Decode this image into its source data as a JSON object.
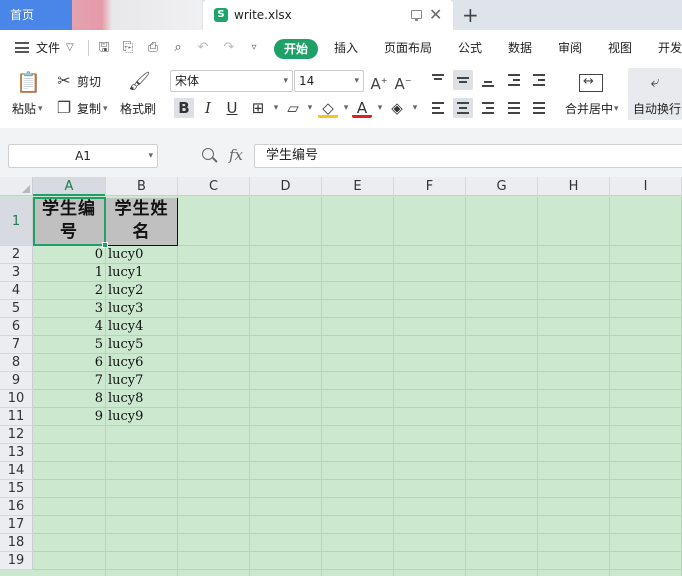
{
  "tabs": {
    "home": "首页",
    "file": "write.xlsx",
    "add": "+"
  },
  "menu": {
    "file": "文件",
    "items": [
      "开始",
      "插入",
      "页面布局",
      "公式",
      "数据",
      "审阅",
      "视图",
      "开发"
    ]
  },
  "ribbon": {
    "paste": "粘贴",
    "cut": "剪切",
    "copy": "复制",
    "format_painter": "格式刷",
    "font_name": "宋体",
    "font_size": "14",
    "merge_center": "合并居中",
    "wrap_text": "自动换行"
  },
  "formula": {
    "cell_ref": "A1",
    "fx": "fx",
    "value": "学生编号"
  },
  "sheet": {
    "columns": [
      "A",
      "B",
      "C",
      "D",
      "E",
      "F",
      "G",
      "H",
      "I"
    ],
    "rows": [
      "1",
      "2",
      "3",
      "4",
      "5",
      "6",
      "7",
      "8",
      "9",
      "10",
      "11",
      "12",
      "13",
      "14",
      "15",
      "16",
      "17",
      "18",
      "19"
    ],
    "header": {
      "a1": "学生编号",
      "b1": "学生姓名"
    },
    "data": [
      {
        "id": "0",
        "name": "lucy0"
      },
      {
        "id": "1",
        "name": "lucy1"
      },
      {
        "id": "2",
        "name": "lucy2"
      },
      {
        "id": "3",
        "name": "lucy3"
      },
      {
        "id": "4",
        "name": "lucy4"
      },
      {
        "id": "5",
        "name": "lucy5"
      },
      {
        "id": "6",
        "name": "lucy6"
      },
      {
        "id": "7",
        "name": "lucy7"
      },
      {
        "id": "8",
        "name": "lucy8"
      },
      {
        "id": "9",
        "name": "lucy9"
      }
    ]
  },
  "colors": {
    "accent": "#1fa068",
    "home_tab": "#4a86e8",
    "grid_bg": "#cce8cf",
    "header_fill": "#c0c0c0"
  }
}
